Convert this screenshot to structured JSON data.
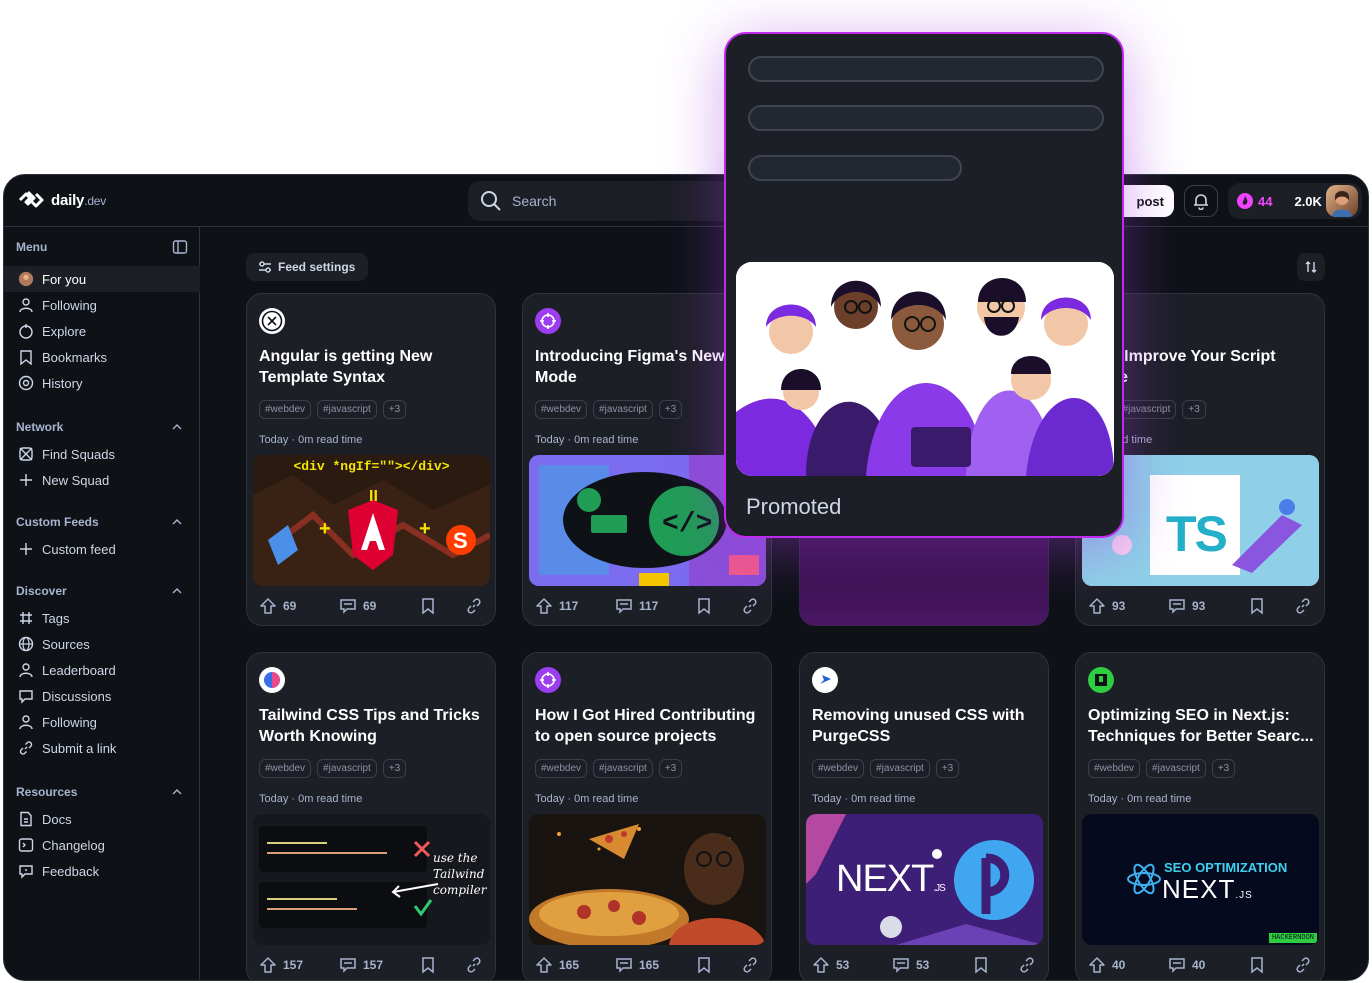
{
  "brand": {
    "name": "daily",
    "suffix": ".dev"
  },
  "search": {
    "placeholder": "Search"
  },
  "header": {
    "new_post": "post",
    "streak": "44",
    "reputation": "2.0K"
  },
  "sidebar": {
    "menu_title": "Menu",
    "menu": [
      {
        "label": "For you"
      },
      {
        "label": "Following"
      },
      {
        "label": "Explore"
      },
      {
        "label": "Bookmarks"
      },
      {
        "label": "History"
      }
    ],
    "network_title": "Network",
    "network": [
      {
        "label": "Find Squads"
      },
      {
        "label": "New Squad"
      }
    ],
    "custom_title": "Custom Feeds",
    "custom": [
      {
        "label": "Custom feed"
      }
    ],
    "discover_title": "Discover",
    "discover": [
      {
        "label": "Tags"
      },
      {
        "label": "Sources"
      },
      {
        "label": "Leaderboard"
      },
      {
        "label": "Discussions"
      },
      {
        "label": "Following"
      },
      {
        "label": "Submit a link"
      }
    ],
    "resources_title": "Resources",
    "resources": [
      {
        "label": "Docs"
      },
      {
        "label": "Changelog"
      },
      {
        "label": "Feedback"
      }
    ]
  },
  "feed": {
    "settings_label": "Feed settings"
  },
  "cards": [
    {
      "title": "Angular is getting New Template Syntax",
      "tags": [
        "#webdev",
        "#javascript",
        "+3"
      ],
      "meta": "Today · 0m read time",
      "upvotes": "69",
      "comments": "69",
      "thumb_code": "<div *ngIf=\"\"></div>"
    },
    {
      "title": "Introducing Figma's New I Mode",
      "tags": [
        "#webdev",
        "#javascript",
        "+3"
      ],
      "meta": "Today · 0m read time",
      "upvotes": "117",
      "comments": "117"
    },
    {
      "title": "s To Improve Your Script Code",
      "tags": [
        "ev",
        "#javascript",
        "+3"
      ],
      "meta": "0m read time",
      "upvotes": "93",
      "comments": "93",
      "thumb_text": "TS"
    },
    {
      "title": "Tailwind CSS Tips and Tricks Worth Knowing",
      "tags": [
        "#webdev",
        "#javascript",
        "+3"
      ],
      "meta": "Today · 0m read time",
      "upvotes": "157",
      "comments": "157",
      "thumb_note": "use the Tailwind compiler"
    },
    {
      "title": "How I Got Hired Contributing to open source projects",
      "tags": [
        "#webdev",
        "#javascript",
        "+3"
      ],
      "meta": "Today · 0m read time",
      "upvotes": "165",
      "comments": "165"
    },
    {
      "title": "Removing unused CSS with PurgeCSS",
      "tags": [
        "#webdev",
        "#javascript",
        "+3"
      ],
      "meta": "Today · 0m read time",
      "upvotes": "53",
      "comments": "53",
      "thumb_text": "NEXT",
      "thumb_sub": ".JS"
    },
    {
      "title": "Optimizing SEO in Next.js: Techniques for Better Searc...",
      "tags": [
        "#webdev",
        "#javascript",
        "+3"
      ],
      "meta": "Today · 0m read time",
      "upvotes": "40",
      "comments": "40",
      "thumb_text": "SEO OPTIMIZATION",
      "thumb_text2": "NEXT",
      "thumb_sub": ".JS",
      "thumb_badge": "HACKERNOON"
    }
  ],
  "promo": {
    "label": "Promoted"
  }
}
